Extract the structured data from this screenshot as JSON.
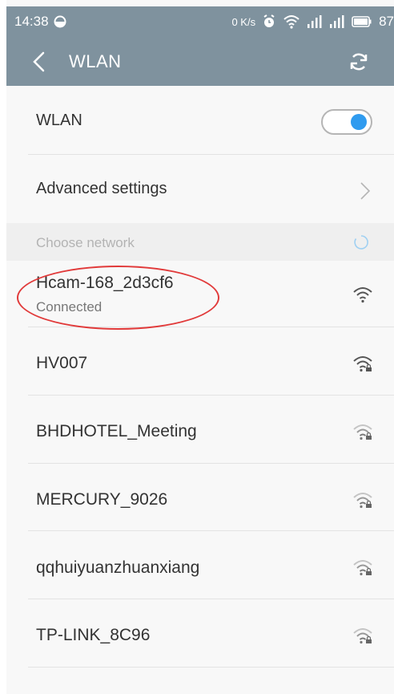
{
  "status_bar": {
    "time": "14:38",
    "data_speed": "0 K/s",
    "battery": "87",
    "icons": [
      "moon-icon",
      "alarm-icon",
      "wifi-icon",
      "signal-4g-icon",
      "signal-icon",
      "battery-icon"
    ]
  },
  "header": {
    "title": "WLAN",
    "back_icon": "back-chevron-icon",
    "refresh_icon": "refresh-icon",
    "background_color": "#7f929e"
  },
  "wlan_toggle": {
    "label": "WLAN",
    "state": "on",
    "accent_color": "#2f9bef"
  },
  "advanced": {
    "label": "Advanced settings"
  },
  "section": {
    "label": "Choose network"
  },
  "networks": [
    {
      "name": "Hcam-168_2d3cf6",
      "status": "Connected",
      "secured": false,
      "strength": "strong",
      "highlighted": true
    },
    {
      "name": "HV007",
      "status": "",
      "secured": true,
      "strength": "strong"
    },
    {
      "name": "BHDHOTEL_Meeting",
      "status": "",
      "secured": true,
      "strength": "medium"
    },
    {
      "name": "MERCURY_9026",
      "status": "",
      "secured": true,
      "strength": "medium"
    },
    {
      "name": "qqhuiyuanzhuanxiang",
      "status": "",
      "secured": true,
      "strength": "medium"
    },
    {
      "name": "TP-LINK_8C96",
      "status": "",
      "secured": true,
      "strength": "medium"
    }
  ],
  "annotation": {
    "type": "red-ellipse",
    "color": "#e13a3a",
    "target": "Hcam-168_2d3cf6"
  }
}
